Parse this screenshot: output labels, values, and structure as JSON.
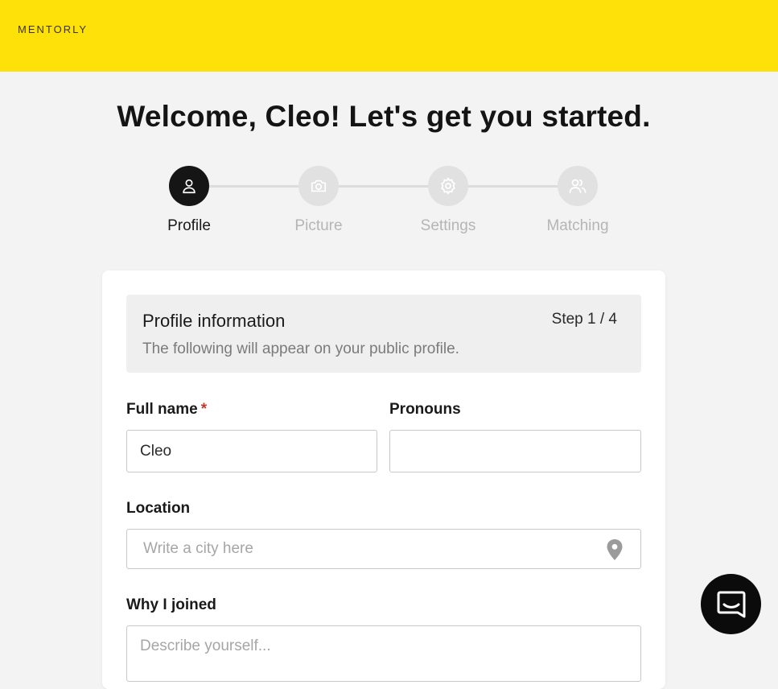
{
  "header": {
    "logo_text": "MENTORLY",
    "background_color": "#ffe10a"
  },
  "welcome_title": "Welcome, Cleo! Let's get you started.",
  "stepper": {
    "steps": [
      {
        "label": "Profile",
        "icon": "user-icon",
        "active": true
      },
      {
        "label": "Picture",
        "icon": "camera-icon",
        "active": false
      },
      {
        "label": "Settings",
        "icon": "gear-icon",
        "active": false
      },
      {
        "label": "Matching",
        "icon": "users-icon",
        "active": false
      }
    ]
  },
  "card": {
    "section_title": "Profile information",
    "step_indicator": "Step 1 / 4",
    "section_description": "The following will appear on your public profile."
  },
  "form": {
    "full_name": {
      "label": "Full name",
      "required_mark": "*",
      "value": "Cleo"
    },
    "pronouns": {
      "label": "Pronouns",
      "value": ""
    },
    "location": {
      "label": "Location",
      "placeholder": "Write a city here",
      "icon": "map-pin-icon"
    },
    "why_joined": {
      "label": "Why I joined",
      "placeholder": "Describe yourself..."
    }
  },
  "chat_widget": {
    "icon": "chat-icon"
  }
}
